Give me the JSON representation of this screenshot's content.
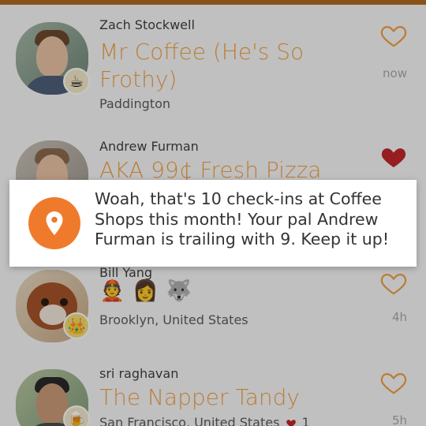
{
  "feed": {
    "items": [
      {
        "user": "Zach Stockwell",
        "venue": "Mr Coffee (He's So Frothy)",
        "location": "Paddington",
        "time": "now",
        "liked": false,
        "badge_icon": "coffee-cup-icon"
      },
      {
        "user": "Andrew Furman",
        "venue": "AKA 99¢ Fresh Pizza",
        "location": "",
        "time": "",
        "liked": true,
        "badge_icon": ""
      },
      {
        "user": "Bill Yang",
        "emoji_row": [
          "👲",
          "👩",
          "🐺"
        ],
        "location": "Brooklyn, United States",
        "time": "4h",
        "liked": false,
        "badge_icon": "crown-icon"
      },
      {
        "user": "sri raghavan",
        "venue": "The Napper Tandy",
        "location": "San Francisco, United States",
        "likes": "1",
        "time": "5h",
        "liked": false,
        "badge_icon": "beer-mug-icon"
      }
    ]
  },
  "toast": {
    "message": "Woah, that's 10 check-ins at Coffee Shops this month! Your pal Andrew Furman is trailing with 9. Keep it up!",
    "icon": "location-pin-icon",
    "icon_color": "#f07a2b"
  },
  "colors": {
    "accent": "#f0a048",
    "heart_liked": "#c1262a",
    "heart_outline": "#f0a048"
  }
}
